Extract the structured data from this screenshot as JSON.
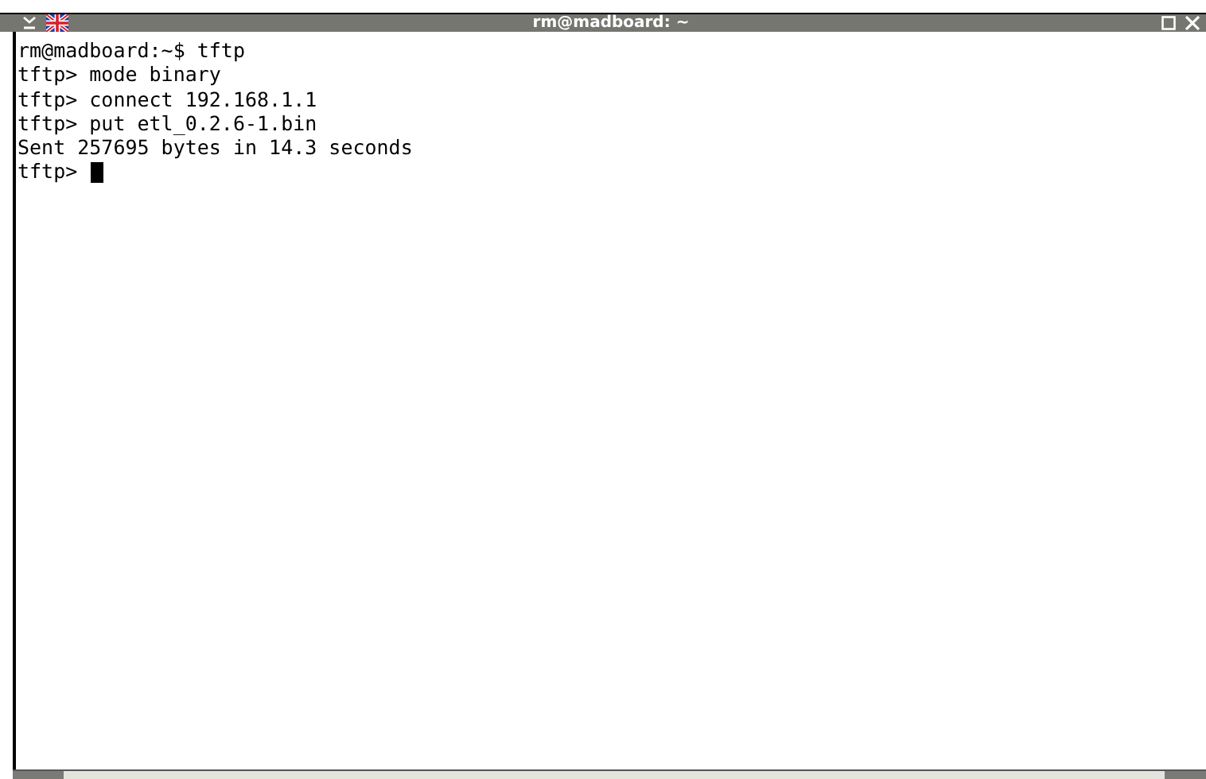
{
  "window": {
    "title": "rm@madboard: ~"
  },
  "terminal": {
    "lines": [
      "rm@madboard:~$ tftp",
      "tftp> mode binary",
      "tftp> connect 192.168.1.1",
      "tftp> put etl_0.2.6-1.bin",
      "Sent 257695 bytes in 14.3 seconds"
    ],
    "prompt": "tftp>"
  }
}
